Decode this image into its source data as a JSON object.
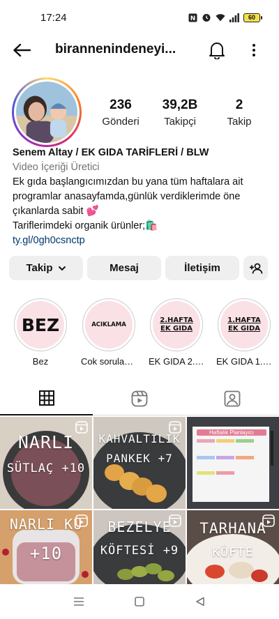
{
  "status": {
    "time": "17:24",
    "battery": "60"
  },
  "header": {
    "username": "birannenindeneyi..."
  },
  "profile": {
    "stats": [
      {
        "value": "236",
        "label": "Gönderi"
      },
      {
        "value": "39,2B",
        "label": "Takipçi"
      },
      {
        "value": "2",
        "label": "Takip"
      }
    ],
    "name": "Senem Altay / EK GIDA TARİFLERİ / BLW",
    "category": "Video İçeriği Üretici",
    "bio_lines": [
      "Ek gıda başlangıcımızdan bu yana tüm haftalara ait",
      "programlar anasayfamda,günlük verdiklerimde öne",
      "çıkanlarda sabit 💕",
      "Tariflerimdeki organik ürünler;🛍️"
    ],
    "link": "ty.gl/0gh0csnctp"
  },
  "buttons": {
    "follow": "Takip",
    "message": "Mesaj",
    "contact": "İletişim"
  },
  "highlights": [
    {
      "cover": "BEZ",
      "label": "Bez"
    },
    {
      "cover": "ACIKLAMA",
      "label": "Cok sorulanlar"
    },
    {
      "cover": "2.HAFTA EK GIDA",
      "label": "EK GIDA 2.HA..."
    },
    {
      "cover": "1.HAFTA EK GIDA",
      "label": "EK GIDA 1.HA..."
    }
  ],
  "tabs": [
    {
      "icon": "grid-icon"
    },
    {
      "icon": "reels-icon"
    },
    {
      "icon": "tagged-icon"
    }
  ],
  "posts": [
    {
      "line1": "NARLI",
      "line2": "SÜTLAÇ +10"
    },
    {
      "line1": "KAHVALTILIK",
      "line2": "PANKEK +7"
    },
    {
      "title": "Haftalık Planlayıcı"
    },
    {
      "line1": "NARLI KU",
      "line2": "+10"
    },
    {
      "line1": "BEZELYE",
      "line2": "KÖFTESİ +9"
    },
    {
      "line1": "TARHANA",
      "line2": "KÖFTE"
    }
  ]
}
